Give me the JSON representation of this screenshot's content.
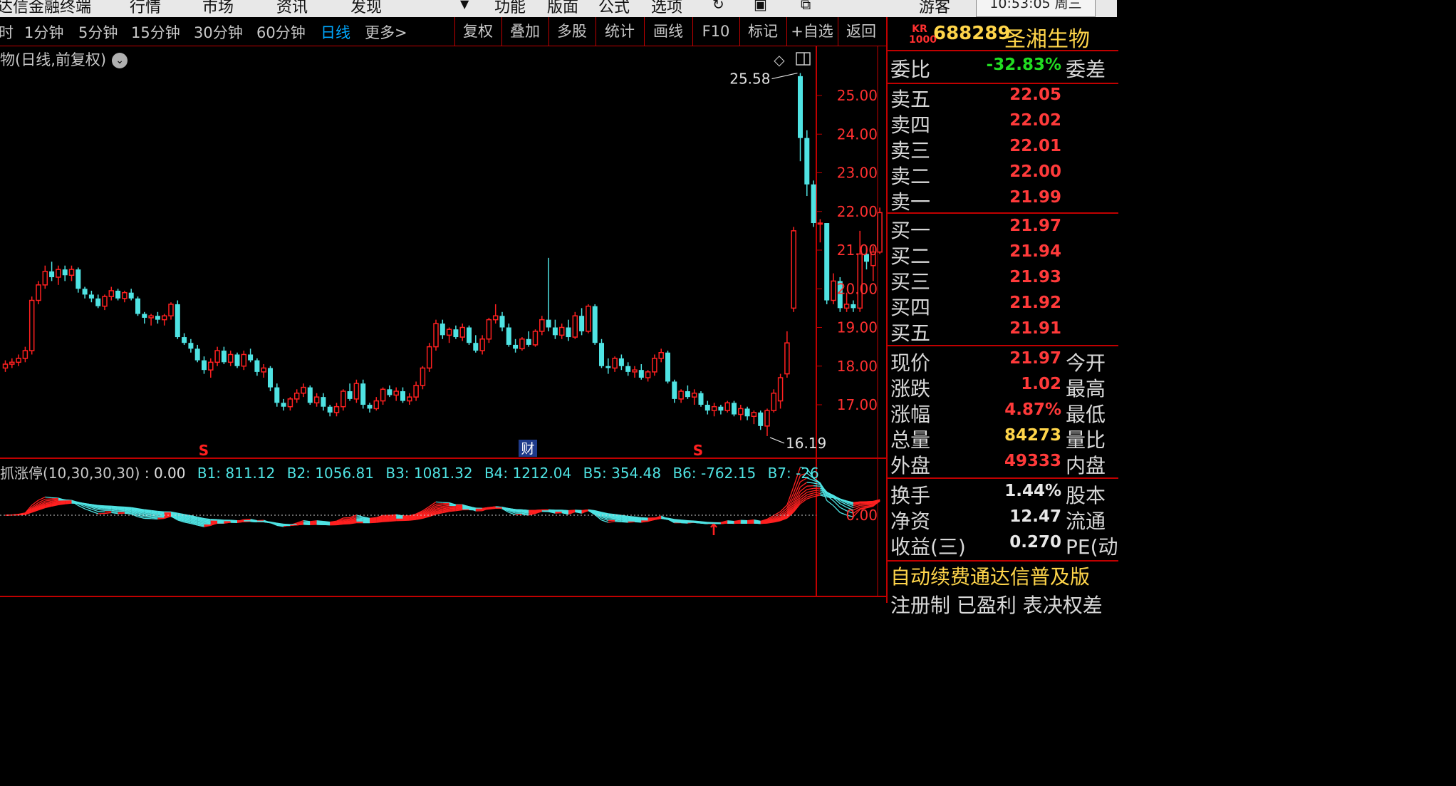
{
  "menubar": {
    "items": [
      "达信金融终端",
      "行情",
      "市场",
      "资讯",
      "发现",
      "功能",
      "版面",
      "公式",
      "选项",
      "游客"
    ],
    "clock": "10:53:05 周三"
  },
  "toolbar": {
    "periods": [
      "时",
      "1分钟",
      "5分钟",
      "15分钟",
      "30分钟",
      "60分钟",
      "日线",
      "更多>"
    ],
    "active_period": "日线",
    "buttons": [
      "复权",
      "叠加",
      "多股",
      "统计",
      "画线",
      "F10",
      "标记",
      "+自选",
      "返回"
    ]
  },
  "chart": {
    "title": "物(日线,前复权)",
    "title_dropdown": "chevron-down",
    "price_ticks": [
      "25.00",
      "24.00",
      "23.00",
      "22.00",
      "21.00",
      "20.00",
      "19.00",
      "18.00",
      "17.00"
    ],
    "high_label": "25.58",
    "low_label": "16.19",
    "marker_s": "S",
    "marker_cai": "财",
    "colors": {
      "up": "#ff2020",
      "down": "#4fe3e3",
      "axis": "#c00000",
      "tick_text": "#ff3030"
    }
  },
  "indicator": {
    "name": "抓涨停(10,30,30,30)",
    "main_value": ": 0.00",
    "values": [
      "B1: 811.12",
      "B2: 1056.81",
      "B3: 1081.32",
      "B4: 1212.04",
      "B5: 354.48",
      "B6: -762.15",
      "B7: -26"
    ],
    "zero_tick": "0.00"
  },
  "chart_data": {
    "type": "candlestick",
    "y_unit": "price",
    "ylim": [
      16.0,
      25.8
    ],
    "high": 25.58,
    "low": 16.19,
    "candles": [
      [
        17.95,
        18.15,
        17.85,
        18.05
      ],
      [
        18.05,
        18.2,
        17.95,
        18.1
      ],
      [
        18.1,
        18.3,
        18.0,
        18.2
      ],
      [
        18.2,
        18.5,
        18.1,
        18.4
      ],
      [
        18.4,
        19.8,
        18.3,
        19.7
      ],
      [
        19.7,
        20.2,
        19.6,
        20.1
      ],
      [
        20.1,
        20.6,
        20.0,
        20.45
      ],
      [
        20.45,
        20.7,
        20.2,
        20.3
      ],
      [
        20.3,
        20.6,
        20.1,
        20.5
      ],
      [
        20.5,
        20.6,
        20.2,
        20.35
      ],
      [
        20.35,
        20.6,
        20.2,
        20.5
      ],
      [
        20.5,
        20.55,
        19.9,
        20.0
      ],
      [
        20.0,
        20.05,
        19.75,
        19.85
      ],
      [
        19.85,
        19.95,
        19.65,
        19.75
      ],
      [
        19.75,
        19.85,
        19.5,
        19.55
      ],
      [
        19.55,
        19.85,
        19.45,
        19.8
      ],
      [
        19.8,
        20.05,
        19.7,
        19.95
      ],
      [
        19.95,
        20.0,
        19.7,
        19.75
      ],
      [
        19.75,
        19.95,
        19.65,
        19.9
      ],
      [
        19.9,
        20.0,
        19.7,
        19.75
      ],
      [
        19.75,
        19.8,
        19.3,
        19.35
      ],
      [
        19.35,
        19.4,
        19.1,
        19.25
      ],
      [
        19.25,
        19.35,
        19.05,
        19.3
      ],
      [
        19.3,
        19.4,
        19.1,
        19.2
      ],
      [
        19.2,
        19.35,
        19.05,
        19.3
      ],
      [
        19.3,
        19.65,
        19.2,
        19.6
      ],
      [
        19.6,
        19.7,
        18.7,
        18.75
      ],
      [
        18.75,
        18.85,
        18.55,
        18.6
      ],
      [
        18.6,
        18.7,
        18.35,
        18.45
      ],
      [
        18.45,
        18.55,
        18.1,
        18.15
      ],
      [
        18.15,
        18.25,
        17.8,
        17.9
      ],
      [
        17.9,
        18.2,
        17.7,
        18.1
      ],
      [
        18.1,
        18.5,
        18.0,
        18.4
      ],
      [
        18.4,
        18.5,
        18.05,
        18.1
      ],
      [
        18.1,
        18.4,
        18.0,
        18.3
      ],
      [
        18.3,
        18.35,
        17.95,
        18.0
      ],
      [
        18.0,
        18.4,
        17.9,
        18.3
      ],
      [
        18.3,
        18.45,
        18.1,
        18.15
      ],
      [
        18.15,
        18.2,
        17.75,
        17.85
      ],
      [
        17.85,
        18.05,
        17.7,
        17.95
      ],
      [
        17.95,
        18.0,
        17.35,
        17.45
      ],
      [
        17.45,
        17.55,
        16.95,
        17.05
      ],
      [
        17.05,
        17.15,
        16.85,
        16.95
      ],
      [
        16.95,
        17.2,
        16.85,
        17.15
      ],
      [
        17.15,
        17.4,
        17.05,
        17.3
      ],
      [
        17.3,
        17.55,
        17.2,
        17.45
      ],
      [
        17.45,
        17.5,
        17.0,
        17.05
      ],
      [
        17.05,
        17.3,
        16.95,
        17.2
      ],
      [
        17.2,
        17.3,
        16.85,
        16.95
      ],
      [
        16.95,
        17.0,
        16.7,
        16.8
      ],
      [
        16.8,
        17.05,
        16.7,
        16.95
      ],
      [
        16.95,
        17.4,
        16.85,
        17.35
      ],
      [
        17.35,
        17.55,
        17.1,
        17.15
      ],
      [
        17.15,
        17.65,
        17.05,
        17.55
      ],
      [
        17.55,
        17.65,
        16.9,
        17.0
      ],
      [
        17.0,
        17.05,
        16.8,
        16.9
      ],
      [
        16.9,
        17.2,
        16.85,
        17.1
      ],
      [
        17.1,
        17.45,
        17.0,
        17.4
      ],
      [
        17.4,
        17.5,
        17.2,
        17.25
      ],
      [
        17.25,
        17.45,
        17.1,
        17.35
      ],
      [
        17.35,
        17.45,
        17.05,
        17.1
      ],
      [
        17.1,
        17.3,
        17.0,
        17.2
      ],
      [
        17.2,
        17.6,
        17.1,
        17.5
      ],
      [
        17.5,
        18.0,
        17.4,
        17.95
      ],
      [
        17.95,
        18.6,
        17.85,
        18.5
      ],
      [
        18.5,
        19.2,
        18.4,
        19.1
      ],
      [
        19.1,
        19.2,
        18.7,
        18.8
      ],
      [
        18.8,
        19.0,
        18.6,
        18.95
      ],
      [
        18.95,
        19.05,
        18.7,
        18.75
      ],
      [
        18.75,
        19.1,
        18.65,
        19.0
      ],
      [
        19.0,
        19.05,
        18.55,
        18.6
      ],
      [
        18.6,
        18.8,
        18.35,
        18.4
      ],
      [
        18.4,
        18.8,
        18.3,
        18.7
      ],
      [
        18.7,
        19.25,
        18.6,
        19.2
      ],
      [
        19.2,
        19.6,
        19.1,
        19.3
      ],
      [
        19.3,
        19.4,
        18.9,
        19.0
      ],
      [
        19.0,
        19.1,
        18.5,
        18.55
      ],
      [
        18.55,
        18.7,
        18.35,
        18.45
      ],
      [
        18.45,
        18.75,
        18.4,
        18.7
      ],
      [
        18.7,
        18.9,
        18.5,
        18.55
      ],
      [
        18.55,
        18.95,
        18.5,
        18.9
      ],
      [
        18.9,
        19.3,
        18.8,
        19.2
      ],
      [
        19.2,
        20.8,
        18.9,
        19.0
      ],
      [
        19.0,
        19.2,
        18.7,
        18.8
      ],
      [
        18.8,
        19.1,
        18.7,
        19.0
      ],
      [
        19.0,
        19.2,
        18.65,
        18.75
      ],
      [
        18.75,
        19.4,
        18.7,
        19.3
      ],
      [
        19.3,
        19.5,
        18.8,
        18.9
      ],
      [
        18.9,
        19.6,
        18.85,
        19.55
      ],
      [
        19.55,
        19.6,
        18.55,
        18.6
      ],
      [
        18.6,
        18.7,
        17.95,
        18.0
      ],
      [
        18.0,
        18.2,
        17.8,
        17.95
      ],
      [
        17.95,
        18.25,
        17.85,
        18.2
      ],
      [
        18.2,
        18.3,
        17.9,
        18.0
      ],
      [
        18.0,
        18.1,
        17.75,
        17.85
      ],
      [
        17.85,
        18.0,
        17.7,
        17.9
      ],
      [
        17.9,
        18.05,
        17.65,
        17.7
      ],
      [
        17.7,
        17.9,
        17.6,
        17.85
      ],
      [
        17.85,
        18.3,
        17.75,
        18.2
      ],
      [
        18.2,
        18.45,
        18.1,
        18.35
      ],
      [
        18.35,
        18.4,
        17.55,
        17.6
      ],
      [
        17.6,
        17.65,
        17.05,
        17.15
      ],
      [
        17.15,
        17.4,
        17.05,
        17.35
      ],
      [
        17.35,
        17.5,
        17.15,
        17.2
      ],
      [
        17.2,
        17.4,
        17.0,
        17.3
      ],
      [
        17.3,
        17.35,
        16.95,
        17.0
      ],
      [
        17.0,
        17.1,
        16.75,
        16.85
      ],
      [
        16.85,
        17.05,
        16.7,
        16.95
      ],
      [
        16.95,
        17.0,
        16.75,
        16.85
      ],
      [
        16.85,
        17.1,
        16.8,
        17.05
      ],
      [
        17.05,
        17.1,
        16.7,
        16.75
      ],
      [
        16.75,
        17.0,
        16.6,
        16.9
      ],
      [
        16.9,
        16.95,
        16.6,
        16.7
      ],
      [
        16.7,
        16.85,
        16.5,
        16.8
      ],
      [
        16.8,
        16.85,
        16.35,
        16.45
      ],
      [
        16.45,
        16.9,
        16.19,
        16.85
      ],
      [
        16.85,
        17.4,
        16.8,
        17.3
      ],
      [
        17.1,
        17.8,
        16.9,
        17.7
      ],
      [
        17.8,
        18.9,
        17.7,
        18.6
      ],
      [
        19.5,
        21.6,
        19.4,
        21.5
      ],
      [
        25.5,
        25.58,
        23.3,
        23.9
      ],
      [
        23.9,
        24.1,
        22.4,
        22.7
      ],
      [
        22.7,
        22.8,
        21.6,
        21.7
      ],
      [
        21.7,
        21.8,
        21.2,
        21.7
      ],
      [
        21.7,
        21.7,
        19.6,
        19.7
      ],
      [
        19.7,
        20.4,
        19.6,
        20.2
      ],
      [
        20.2,
        20.3,
        19.4,
        19.5
      ],
      [
        19.5,
        19.9,
        19.4,
        19.6
      ],
      [
        19.6,
        19.7,
        19.4,
        19.5
      ],
      [
        19.5,
        21.5,
        19.4,
        20.9
      ],
      [
        20.9,
        21.1,
        20.5,
        20.7
      ],
      [
        20.6,
        21.1,
        20.2,
        20.95
      ],
      [
        20.95,
        22.1,
        20.9,
        21.97
      ]
    ],
    "indicator_zero": 0.0
  },
  "panel": {
    "badge": "KR 1000",
    "code": "688289",
    "name": "圣湘生物",
    "weibi": {
      "label": "委比",
      "value": "-32.83%",
      "extra": "委差"
    },
    "sells": [
      {
        "label": "卖五",
        "value": "22.05"
      },
      {
        "label": "卖四",
        "value": "22.02"
      },
      {
        "label": "卖三",
        "value": "22.01"
      },
      {
        "label": "卖二",
        "value": "22.00"
      },
      {
        "label": "卖一",
        "value": "21.99"
      }
    ],
    "buys": [
      {
        "label": "买一",
        "value": "21.97"
      },
      {
        "label": "买二",
        "value": "21.94"
      },
      {
        "label": "买三",
        "value": "21.93"
      },
      {
        "label": "买四",
        "value": "21.92"
      },
      {
        "label": "买五",
        "value": "21.91"
      }
    ],
    "quote": [
      {
        "label": "现价",
        "value": "21.97",
        "extra": "今开",
        "color": "red"
      },
      {
        "label": "涨跌",
        "value": "1.02",
        "extra": "最高",
        "color": "red"
      },
      {
        "label": "涨幅",
        "value": "4.87%",
        "extra": "最低",
        "color": "red"
      },
      {
        "label": "总量",
        "value": "84273",
        "extra": "量比",
        "color": "yellow"
      },
      {
        "label": "外盘",
        "value": "49333",
        "extra": "内盘",
        "color": "red"
      }
    ],
    "fund": [
      {
        "label": "换手",
        "value": "1.44%",
        "extra": "股本"
      },
      {
        "label": "净资",
        "value": "12.47",
        "extra": "流通"
      },
      {
        "label": "收益(三)",
        "value": "0.270",
        "extra": "PE(动"
      }
    ],
    "ad": "自动续费通达信普及版",
    "reg": "注册制 已盈利 表决权差"
  }
}
